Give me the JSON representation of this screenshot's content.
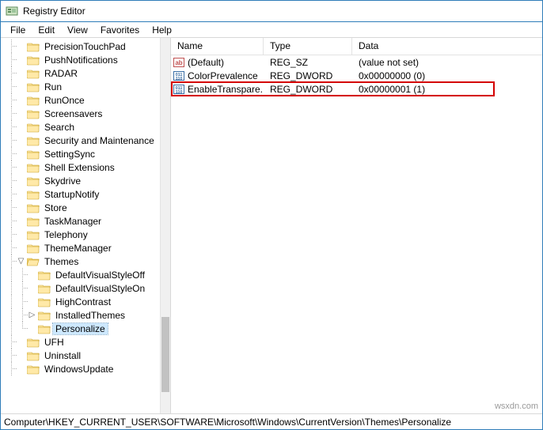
{
  "window": {
    "title": "Registry Editor"
  },
  "menu": {
    "file": "File",
    "edit": "Edit",
    "view": "View",
    "favorites": "Favorites",
    "help": "Help"
  },
  "tree": {
    "items": [
      {
        "label": "PrecisionTouchPad",
        "depth": 1,
        "exp": "",
        "sel": false,
        "last": false
      },
      {
        "label": "PushNotifications",
        "depth": 1,
        "exp": "",
        "sel": false,
        "last": false
      },
      {
        "label": "RADAR",
        "depth": 1,
        "exp": "",
        "sel": false,
        "last": false
      },
      {
        "label": "Run",
        "depth": 1,
        "exp": "",
        "sel": false,
        "last": false
      },
      {
        "label": "RunOnce",
        "depth": 1,
        "exp": "",
        "sel": false,
        "last": false
      },
      {
        "label": "Screensavers",
        "depth": 1,
        "exp": "",
        "sel": false,
        "last": false
      },
      {
        "label": "Search",
        "depth": 1,
        "exp": "",
        "sel": false,
        "last": false
      },
      {
        "label": "Security and Maintenance",
        "depth": 1,
        "exp": "",
        "sel": false,
        "last": false
      },
      {
        "label": "SettingSync",
        "depth": 1,
        "exp": "",
        "sel": false,
        "last": false
      },
      {
        "label": "Shell Extensions",
        "depth": 1,
        "exp": "",
        "sel": false,
        "last": false
      },
      {
        "label": "Skydrive",
        "depth": 1,
        "exp": "",
        "sel": false,
        "last": false
      },
      {
        "label": "StartupNotify",
        "depth": 1,
        "exp": "",
        "sel": false,
        "last": false
      },
      {
        "label": "Store",
        "depth": 1,
        "exp": "",
        "sel": false,
        "last": false
      },
      {
        "label": "TaskManager",
        "depth": 1,
        "exp": "",
        "sel": false,
        "last": false
      },
      {
        "label": "Telephony",
        "depth": 1,
        "exp": "",
        "sel": false,
        "last": false
      },
      {
        "label": "ThemeManager",
        "depth": 1,
        "exp": "",
        "sel": false,
        "last": false
      },
      {
        "label": "Themes",
        "depth": 1,
        "exp": "open",
        "sel": false,
        "last": false
      },
      {
        "label": "DefaultVisualStyleOff",
        "depth": 2,
        "exp": "",
        "sel": false,
        "last": false
      },
      {
        "label": "DefaultVisualStyleOn",
        "depth": 2,
        "exp": "",
        "sel": false,
        "last": false
      },
      {
        "label": "HighContrast",
        "depth": 2,
        "exp": "",
        "sel": false,
        "last": false
      },
      {
        "label": "InstalledThemes",
        "depth": 2,
        "exp": "closed",
        "sel": false,
        "last": false
      },
      {
        "label": "Personalize",
        "depth": 2,
        "exp": "",
        "sel": true,
        "last": true
      },
      {
        "label": "UFH",
        "depth": 1,
        "exp": "",
        "sel": false,
        "last": false
      },
      {
        "label": "Uninstall",
        "depth": 1,
        "exp": "",
        "sel": false,
        "last": false
      },
      {
        "label": "WindowsUpdate",
        "depth": 1,
        "exp": "",
        "sel": false,
        "last": false
      }
    ]
  },
  "columns": {
    "name": "Name",
    "type": "Type",
    "data": "Data"
  },
  "values": [
    {
      "icon": "string",
      "name": "(Default)",
      "type": "REG_SZ",
      "data": "(value not set)",
      "hl": false
    },
    {
      "icon": "dword",
      "name": "ColorPrevalence",
      "type": "REG_DWORD",
      "data": "0x00000000 (0)",
      "hl": false
    },
    {
      "icon": "dword",
      "name": "EnableTranspare...",
      "type": "REG_DWORD",
      "data": "0x00000001 (1)",
      "hl": true
    }
  ],
  "status": {
    "path": "Computer\\HKEY_CURRENT_USER\\SOFTWARE\\Microsoft\\Windows\\CurrentVersion\\Themes\\Personalize"
  },
  "watermark": "wsxdn.com"
}
